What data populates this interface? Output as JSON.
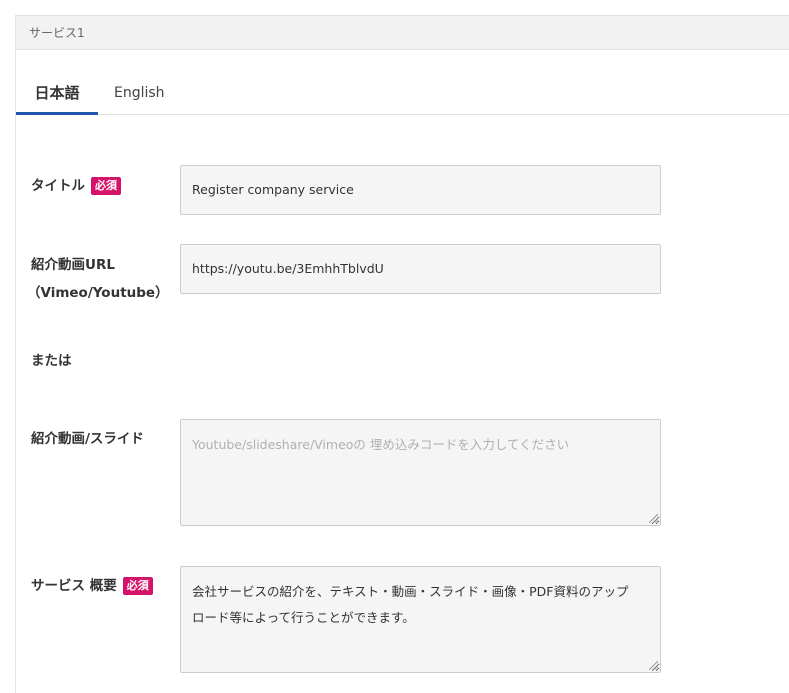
{
  "panel": {
    "header": "サービス1",
    "tabs": [
      {
        "label": "日本語",
        "active": true
      },
      {
        "label": "English",
        "active": false
      }
    ]
  },
  "form": {
    "required_badge": "必須",
    "title": {
      "label": "タイトル",
      "value": "Register company service"
    },
    "video_url": {
      "label_line1": "紹介動画URL",
      "label_line2": "（Vimeo/Youtube）",
      "value": "https://youtu.be/3EmhhTblvdU"
    },
    "or_label": "または",
    "embed": {
      "label": "紹介動画/スライド",
      "placeholder": "Youtube/slideshare/Vimeoの 埋め込みコードを入力してください"
    },
    "overview": {
      "label": "サービス 概要",
      "value_line1": "会社サービスの紹介を、テキスト・動画・スライド・画像・PDF資料のアップ",
      "value_line2": "ロード等によって行うことができます。"
    }
  },
  "colors": {
    "accent_tab": "#2255b0",
    "required_badge": "#d6136b"
  }
}
